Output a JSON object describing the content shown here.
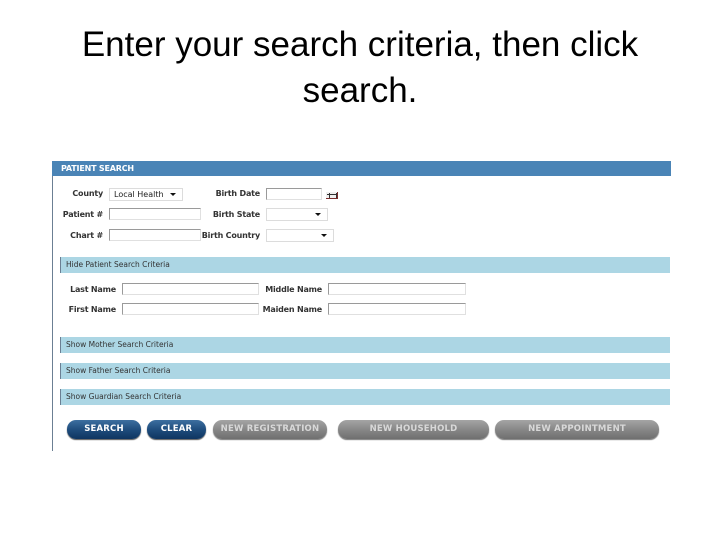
{
  "slide": {
    "title": "Enter your search criteria, then click search."
  },
  "panel": {
    "header": "PATIENT SEARCH",
    "fields": {
      "county": {
        "label": "County",
        "value": "Local Health"
      },
      "birth_date": {
        "label": "Birth Date",
        "value": ""
      },
      "patient_number": {
        "label": "Patient #",
        "value": ""
      },
      "birth_state": {
        "label": "Birth State",
        "value": ""
      },
      "chart_number": {
        "label": "Chart #",
        "value": ""
      },
      "birth_country": {
        "label": "Birth Country",
        "value": ""
      }
    },
    "patient_section": {
      "toggle_label": "Hide Patient Search Criteria",
      "last_name": {
        "label": "Last Name",
        "value": ""
      },
      "middle_name": {
        "label": "Middle Name",
        "value": ""
      },
      "first_name": {
        "label": "First Name",
        "value": ""
      },
      "maiden_name": {
        "label": "Maiden Name",
        "value": ""
      }
    },
    "collapsed_sections": [
      {
        "label": "Show Mother Search Criteria"
      },
      {
        "label": "Show Father Search Criteria"
      },
      {
        "label": "Show Guardian Search Criteria"
      }
    ],
    "buttons": {
      "search": "SEARCH",
      "clear": "CLEAR",
      "new_registration": "NEW REGISTRATION",
      "new_household": "NEW HOUSEHOLD",
      "new_appointment": "NEW APPOINTMENT"
    }
  },
  "colors": {
    "header_bar": "#4a84b6",
    "section_bar": "#acd6e4",
    "primary_button": "#1d4a7a",
    "disabled_button": "#858585"
  }
}
